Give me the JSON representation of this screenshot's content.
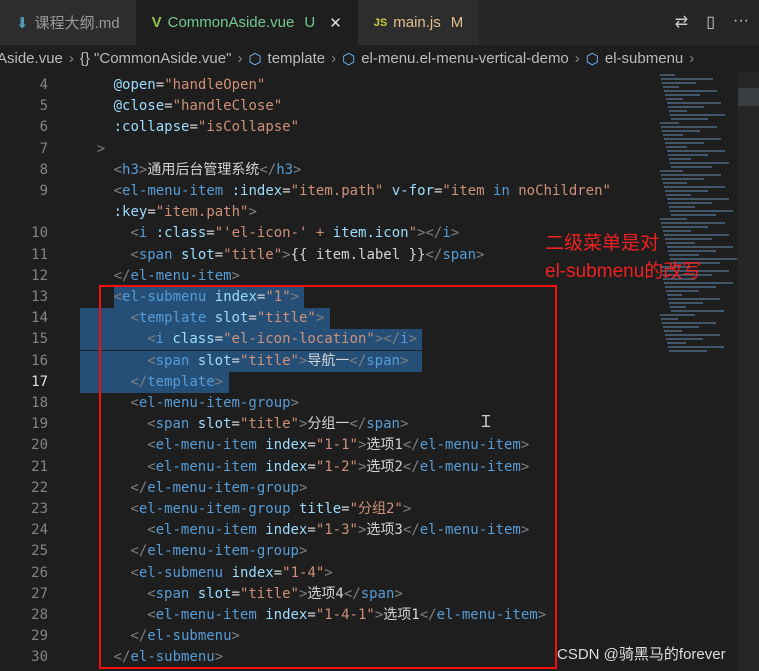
{
  "tabs": [
    {
      "icon": "markdown-download-icon",
      "label": "课程大纲.md",
      "status": ""
    },
    {
      "icon": "vue-icon",
      "label": "CommonAside.vue",
      "status": "U",
      "active": true
    },
    {
      "icon": "js-icon",
      "label": "main.js",
      "status": "M"
    }
  ],
  "tab_icons": {
    "vue": "V",
    "js": "JS",
    "md": "⬇",
    "close": "✕"
  },
  "actions": {
    "compare": "⇄",
    "split": "▯",
    "more": "···"
  },
  "breadcrumb": [
    "Aside.vue",
    "{} \"CommonAside.vue\"",
    "template",
    "el-menu.el-menu-vertical-demo",
    "el-submenu"
  ],
  "code_lines": [
    {
      "n": "4",
      "i": 4,
      "tk": [
        [
          "a",
          "@open"
        ],
        [
          "x",
          "="
        ],
        [
          "s",
          "\"handleOpen\""
        ]
      ]
    },
    {
      "n": "5",
      "i": 4,
      "tk": [
        [
          "a",
          "@close"
        ],
        [
          "x",
          "="
        ],
        [
          "s",
          "\"handleClose\""
        ]
      ]
    },
    {
      "n": "6",
      "i": 4,
      "tk": [
        [
          "a",
          ":collapse"
        ],
        [
          "x",
          "="
        ],
        [
          "s",
          "\"isCollapse\""
        ]
      ]
    },
    {
      "n": "7",
      "i": 2,
      "tk": [
        [
          "b",
          ">"
        ]
      ]
    },
    {
      "n": "8",
      "i": 4,
      "tk": [
        [
          "b",
          "<"
        ],
        [
          "t",
          "h3"
        ],
        [
          "b",
          ">"
        ],
        [
          "x",
          "通用后台管理系统"
        ],
        [
          "b",
          "</"
        ],
        [
          "t",
          "h3"
        ],
        [
          "b",
          ">"
        ]
      ]
    },
    {
      "n": "9",
      "i": 4,
      "tk": [
        [
          "b",
          "<"
        ],
        [
          "t",
          "el-menu-item"
        ],
        [
          "x",
          " "
        ],
        [
          "a",
          ":index"
        ],
        [
          "x",
          "="
        ],
        [
          "s",
          "\"item.path\""
        ],
        [
          "x",
          " "
        ],
        [
          "a",
          "v-for"
        ],
        [
          "x",
          "="
        ],
        [
          "s",
          "\"item "
        ],
        [
          "k",
          "in"
        ],
        [
          "s",
          " noChildren\""
        ]
      ]
    },
    {
      "n": "",
      "i": 4,
      "tk": [
        [
          "a",
          ":key"
        ],
        [
          "x",
          "="
        ],
        [
          "s",
          "\"item.path\""
        ],
        [
          "b",
          ">"
        ]
      ]
    },
    {
      "n": "10",
      "i": 6,
      "tk": [
        [
          "b",
          "<"
        ],
        [
          "t",
          "i"
        ],
        [
          "x",
          " "
        ],
        [
          "a",
          ":class"
        ],
        [
          "x",
          "="
        ],
        [
          "s",
          "\"'el-icon-' + "
        ],
        [
          "a",
          "item.icon"
        ],
        [
          "s",
          "\""
        ],
        [
          "b",
          "></"
        ],
        [
          "t",
          "i"
        ],
        [
          "b",
          ">"
        ]
      ]
    },
    {
      "n": "11",
      "i": 6,
      "tk": [
        [
          "b",
          "<"
        ],
        [
          "t",
          "span"
        ],
        [
          "x",
          " "
        ],
        [
          "a",
          "slot"
        ],
        [
          "x",
          "="
        ],
        [
          "s",
          "\"title\""
        ],
        [
          "b",
          ">"
        ],
        [
          "x",
          "{{ item.label }}"
        ],
        [
          "b",
          "</"
        ],
        [
          "t",
          "span"
        ],
        [
          "b",
          ">"
        ]
      ]
    },
    {
      "n": "12",
      "i": 4,
      "tk": [
        [
          "b",
          "</"
        ],
        [
          "t",
          "el-menu-item"
        ],
        [
          "b",
          ">"
        ]
      ]
    },
    {
      "n": "13",
      "i": 4,
      "sel": true,
      "tk": [
        [
          "b",
          "<"
        ],
        [
          "t",
          "el-submenu"
        ],
        [
          "x",
          " "
        ],
        [
          "a",
          "index"
        ],
        [
          "x",
          "="
        ],
        [
          "s",
          "\"1\""
        ],
        [
          "b",
          ">"
        ]
      ]
    },
    {
      "n": "14",
      "i": 6,
      "sel": true,
      "tk": [
        [
          "b",
          "<"
        ],
        [
          "t",
          "template"
        ],
        [
          "x",
          " "
        ],
        [
          "a",
          "slot"
        ],
        [
          "x",
          "="
        ],
        [
          "s",
          "\"title\""
        ],
        [
          "b",
          ">"
        ]
      ]
    },
    {
      "n": "15",
      "i": 8,
      "sel": true,
      "tk": [
        [
          "b",
          "<"
        ],
        [
          "t",
          "i"
        ],
        [
          "x",
          " "
        ],
        [
          "a",
          "class"
        ],
        [
          "x",
          "="
        ],
        [
          "s",
          "\"el-icon-location\""
        ],
        [
          "b",
          "></"
        ],
        [
          "t",
          "i"
        ],
        [
          "b",
          ">"
        ]
      ]
    },
    {
      "n": "16",
      "i": 8,
      "sel": true,
      "tk": [
        [
          "b",
          "<"
        ],
        [
          "t",
          "span"
        ],
        [
          "x",
          " "
        ],
        [
          "a",
          "slot"
        ],
        [
          "x",
          "="
        ],
        [
          "s",
          "\"title\""
        ],
        [
          "b",
          ">"
        ],
        [
          "x",
          "导航一"
        ],
        [
          "b",
          "</"
        ],
        [
          "t",
          "span"
        ],
        [
          "b",
          ">"
        ]
      ]
    },
    {
      "n": "17",
      "i": 6,
      "sel": true,
      "cur": true,
      "tk": [
        [
          "b",
          "</"
        ],
        [
          "t",
          "template"
        ],
        [
          "b",
          ">"
        ]
      ]
    },
    {
      "n": "18",
      "i": 6,
      "tk": [
        [
          "b",
          "<"
        ],
        [
          "t",
          "el-menu-item-group"
        ],
        [
          "b",
          ">"
        ]
      ]
    },
    {
      "n": "19",
      "i": 8,
      "tk": [
        [
          "b",
          "<"
        ],
        [
          "t",
          "span"
        ],
        [
          "x",
          " "
        ],
        [
          "a",
          "slot"
        ],
        [
          "x",
          "="
        ],
        [
          "s",
          "\"title\""
        ],
        [
          "b",
          ">"
        ],
        [
          "x",
          "分组一"
        ],
        [
          "b",
          "</"
        ],
        [
          "t",
          "span"
        ],
        [
          "b",
          ">"
        ]
      ]
    },
    {
      "n": "20",
      "i": 8,
      "tk": [
        [
          "b",
          "<"
        ],
        [
          "t",
          "el-menu-item"
        ],
        [
          "x",
          " "
        ],
        [
          "a",
          "index"
        ],
        [
          "x",
          "="
        ],
        [
          "s",
          "\"1-1\""
        ],
        [
          "b",
          ">"
        ],
        [
          "x",
          "选项1"
        ],
        [
          "b",
          "</"
        ],
        [
          "t",
          "el-menu-item"
        ],
        [
          "b",
          ">"
        ]
      ]
    },
    {
      "n": "21",
      "i": 8,
      "tk": [
        [
          "b",
          "<"
        ],
        [
          "t",
          "el-menu-item"
        ],
        [
          "x",
          " "
        ],
        [
          "a",
          "index"
        ],
        [
          "x",
          "="
        ],
        [
          "s",
          "\"1-2\""
        ],
        [
          "b",
          ">"
        ],
        [
          "x",
          "选项2"
        ],
        [
          "b",
          "</"
        ],
        [
          "t",
          "el-menu-item"
        ],
        [
          "b",
          ">"
        ]
      ]
    },
    {
      "n": "22",
      "i": 6,
      "tk": [
        [
          "b",
          "</"
        ],
        [
          "t",
          "el-menu-item-group"
        ],
        [
          "b",
          ">"
        ]
      ]
    },
    {
      "n": "23",
      "i": 6,
      "tk": [
        [
          "b",
          "<"
        ],
        [
          "t",
          "el-menu-item-group"
        ],
        [
          "x",
          " "
        ],
        [
          "a",
          "title"
        ],
        [
          "x",
          "="
        ],
        [
          "s",
          "\"分组2\""
        ],
        [
          "b",
          ">"
        ]
      ]
    },
    {
      "n": "24",
      "i": 8,
      "tk": [
        [
          "b",
          "<"
        ],
        [
          "t",
          "el-menu-item"
        ],
        [
          "x",
          " "
        ],
        [
          "a",
          "index"
        ],
        [
          "x",
          "="
        ],
        [
          "s",
          "\"1-3\""
        ],
        [
          "b",
          ">"
        ],
        [
          "x",
          "选项3"
        ],
        [
          "b",
          "</"
        ],
        [
          "t",
          "el-menu-item"
        ],
        [
          "b",
          ">"
        ]
      ]
    },
    {
      "n": "25",
      "i": 6,
      "tk": [
        [
          "b",
          "</"
        ],
        [
          "t",
          "el-menu-item-group"
        ],
        [
          "b",
          ">"
        ]
      ]
    },
    {
      "n": "26",
      "i": 6,
      "tk": [
        [
          "b",
          "<"
        ],
        [
          "t",
          "el-submenu"
        ],
        [
          "x",
          " "
        ],
        [
          "a",
          "index"
        ],
        [
          "x",
          "="
        ],
        [
          "s",
          "\"1-4\""
        ],
        [
          "b",
          ">"
        ]
      ]
    },
    {
      "n": "27",
      "i": 8,
      "tk": [
        [
          "b",
          "<"
        ],
        [
          "t",
          "span"
        ],
        [
          "x",
          " "
        ],
        [
          "a",
          "slot"
        ],
        [
          "x",
          "="
        ],
        [
          "s",
          "\"title\""
        ],
        [
          "b",
          ">"
        ],
        [
          "x",
          "选项4"
        ],
        [
          "b",
          "</"
        ],
        [
          "t",
          "span"
        ],
        [
          "b",
          ">"
        ]
      ]
    },
    {
      "n": "28",
      "i": 8,
      "tk": [
        [
          "b",
          "<"
        ],
        [
          "t",
          "el-menu-item"
        ],
        [
          "x",
          " "
        ],
        [
          "a",
          "index"
        ],
        [
          "x",
          "="
        ],
        [
          "s",
          "\"1-4-1\""
        ],
        [
          "b",
          ">"
        ],
        [
          "x",
          "选项1"
        ],
        [
          "b",
          "</"
        ],
        [
          "t",
          "el-menu-item"
        ],
        [
          "b",
          ">"
        ]
      ]
    },
    {
      "n": "29",
      "i": 6,
      "tk": [
        [
          "b",
          "</"
        ],
        [
          "t",
          "el-submenu"
        ],
        [
          "b",
          ">"
        ]
      ]
    },
    {
      "n": "30",
      "i": 4,
      "tk": [
        [
          "b",
          "</"
        ],
        [
          "t",
          "el-submenu"
        ],
        [
          "b",
          ">"
        ]
      ]
    }
  ],
  "annotation": [
    "二级菜单是对",
    "el-submenu的改写"
  ],
  "watermark": "CSDN @骑黑马的forever",
  "colors": {
    "annotation": "#f02020",
    "selection": "#264f78",
    "tag": "#569cd6",
    "attr": "#9cdcfe",
    "string": "#ce9178"
  }
}
